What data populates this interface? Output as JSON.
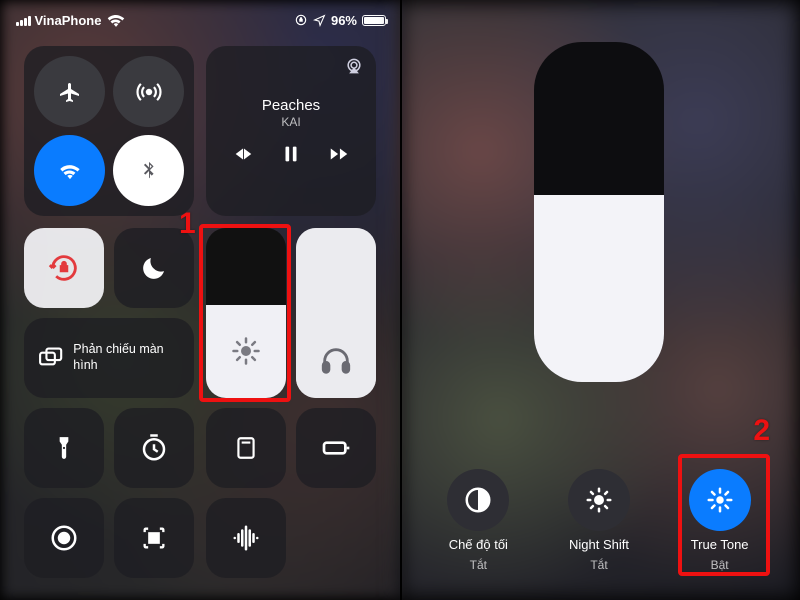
{
  "status": {
    "carrier": "VinaPhone",
    "battery_pct": "96%"
  },
  "connectivity": {
    "airplane": "airplane-icon",
    "cellular": "cellular-icon",
    "wifi": "wifi-icon",
    "bluetooth": "bluetooth-icon"
  },
  "music": {
    "title": "Peaches",
    "artist": "KAI"
  },
  "screen_mirror": "Phản chiếu màn hình",
  "brightness_fill_pct": 55,
  "big_brightness_fill_pct": 55,
  "annotations": {
    "step1": "1",
    "step2": "2"
  },
  "display_options": [
    {
      "id": "dark-mode",
      "label": "Chế độ tối",
      "sub": "Tắt",
      "active": false,
      "icon": "half-circle"
    },
    {
      "id": "night-shift",
      "label": "Night Shift",
      "sub": "Tắt",
      "active": false,
      "icon": "sun-simple"
    },
    {
      "id": "true-tone",
      "label": "True Tone",
      "sub": "Bật",
      "active": true,
      "icon": "sun-bars"
    }
  ],
  "colors": {
    "accent": "#0a7cff",
    "highlight": "#e11"
  }
}
